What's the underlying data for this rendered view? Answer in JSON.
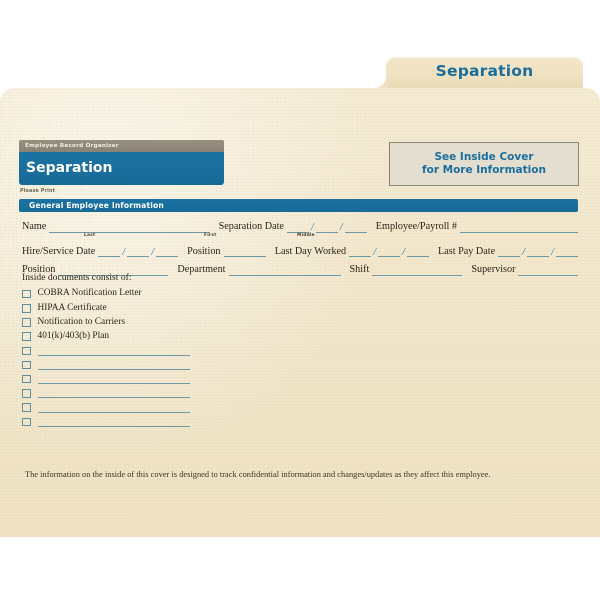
{
  "folder": {
    "tab_label": "Separation"
  },
  "title_card": {
    "eyebrow": "Employee Record Organizer",
    "title": "Separation",
    "note": "Please Print"
  },
  "inside_box": {
    "line1": "See Inside Cover",
    "line2": "for More Information"
  },
  "section": {
    "heading": "General Employee Information"
  },
  "form": {
    "row1": {
      "name_label": "Name",
      "sub_last": "Last",
      "sub_first": "First",
      "sub_middle": "Middle",
      "separation_date_label": "Separation Date",
      "employee_payroll_label": "Employee/Payroll #",
      "slash": "/"
    },
    "row2": {
      "hire_service_date_label": "Hire/Service Date",
      "position_label": "Position",
      "last_day_worked_label": "Last Day Worked",
      "last_pay_date_label": "Last Pay Date",
      "slash": "/"
    },
    "row3": {
      "position_label": "Position",
      "department_label": "Department",
      "shift_label": "Shift",
      "supervisor_label": "Supervisor"
    }
  },
  "checklist": {
    "intro": "Inside documents consist of:",
    "items": [
      {
        "label": "COBRA Notification Letter",
        "blank": false
      },
      {
        "label": "HIPAA Certificate",
        "blank": false
      },
      {
        "label": "Notification to Carriers",
        "blank": false
      },
      {
        "label": "401(k)/403(b) Plan",
        "blank": false
      },
      {
        "label": "",
        "blank": true
      },
      {
        "label": "",
        "blank": true
      },
      {
        "label": "",
        "blank": true
      },
      {
        "label": "",
        "blank": true
      },
      {
        "label": "",
        "blank": true
      },
      {
        "label": "",
        "blank": true
      }
    ]
  },
  "footer": {
    "note": "The information on the inside of this cover is designed to track confidential information and changes/updates as they affect this employee."
  },
  "colors": {
    "brand_blue": "#1b6d9c",
    "folder_cream": "#f3e8cd",
    "rule_teal": "#6e9aa8",
    "eyebrow_gray": "#8a8274",
    "inside_box_fill": "#e4ded0"
  }
}
